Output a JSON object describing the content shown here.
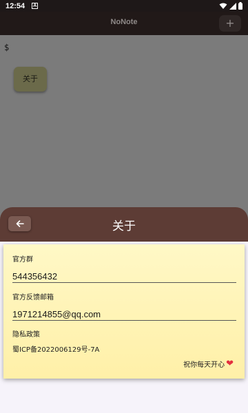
{
  "status_bar": {
    "time": "12:54",
    "notification_letter": "A"
  },
  "app_bar": {
    "title": "NoNote",
    "add_label": "+"
  },
  "background": {
    "prompt_symbol": "$",
    "about_chip_label": "关于"
  },
  "sheet": {
    "title": "关于",
    "back_icon": "arrow-left-icon",
    "fields": [
      {
        "label": "官方群",
        "value": "544356432"
      },
      {
        "label": "官方反馈邮箱",
        "value": "1971214855@qq.com"
      }
    ],
    "privacy_label": "隐私政策",
    "icp_text": "蜀ICP备2022006129号-7A",
    "wish_text": "祝你每天开心",
    "heart_icon": "❤"
  },
  "colors": {
    "sheet_header": "#5d3c35",
    "card": "#fff4b8",
    "heart": "#e3303f"
  }
}
